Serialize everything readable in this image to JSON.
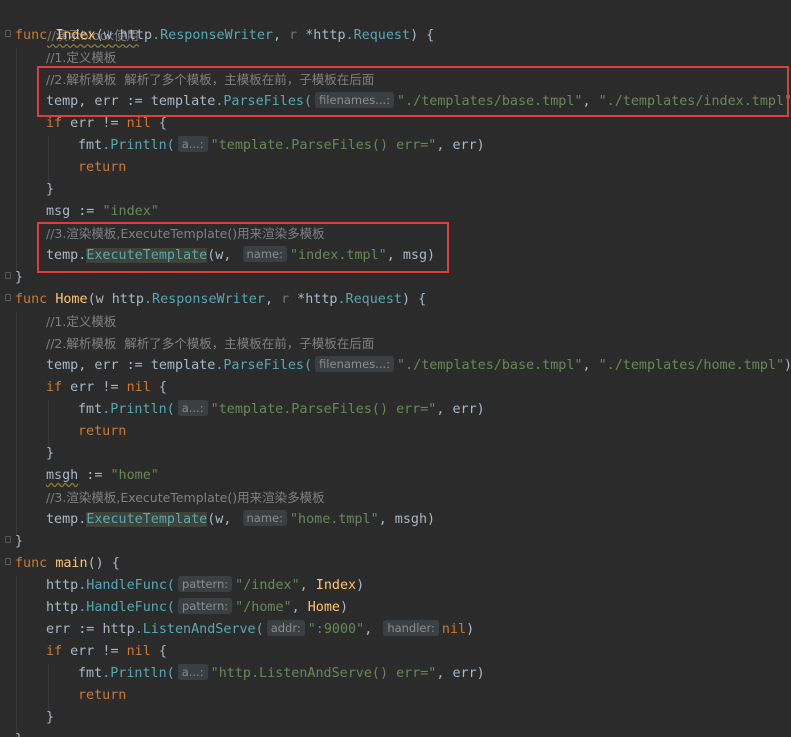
{
  "editor": {
    "title_comment": "//演示block使用",
    "index_func": {
      "kw_func": "func",
      "name": "Index",
      "sig_open": "(w ",
      "writer_pkg": "http",
      "writer_type": ".ResponseWriter",
      "sep": ", ",
      "r_param": "r",
      "req_pkg": " *http",
      "req_type": ".Request",
      "sig_close": ") {",
      "c1": "//1.定义模板",
      "c2": "//2.解析模板  解析了多个模板，主模板在前，子模板在后面",
      "parse_lhs": "temp, err := ",
      "parse_pkg": "template",
      "parse_fn": ".ParseFiles(",
      "parse_hint": "filenames...:",
      "parse_arg1": "\"./templates/base.tmpl\"",
      "parse_comma": ", ",
      "parse_arg2": "\"./templates/index.tmpl\"",
      "parse_close": ")",
      "if_kw": "if",
      "if_cond": " err != ",
      "nil": "nil",
      "if_open": " {",
      "println_pkg": "fmt",
      "println_fn": ".Println(",
      "println_hint": "a...:",
      "println_str": "\"template.ParseFiles() err=\"",
      "println_rest": ", err)",
      "return_kw": "return",
      "close_brace": "}",
      "msg_lhs": "msg := ",
      "msg_str": "\"index\"",
      "c3": "//3.渲染模板,ExecuteTemplate()用来渲染多模板",
      "exec_recv": "temp.",
      "exec_fn": "ExecuteTemplate",
      "exec_open": "(w, ",
      "exec_hint": "name:",
      "exec_str": "\"index.tmpl\"",
      "exec_rest": ", msg)",
      "func_close": "}"
    },
    "home_func": {
      "kw_func": "func",
      "name": "Home",
      "sig_open": "(w ",
      "writer_pkg": "http",
      "writer_type": ".ResponseWriter",
      "sep": ", ",
      "r_param": "r",
      "req_pkg": " *http",
      "req_type": ".Request",
      "sig_close": ") {",
      "c1": "//1.定义模板",
      "c2": "//2.解析模板  解析了多个模板，主模板在前，子模板在后面",
      "parse_lhs": "temp, err := ",
      "parse_pkg": "template",
      "parse_fn": ".ParseFiles(",
      "parse_hint": "filenames...:",
      "parse_arg1": "\"./templates/base.tmpl\"",
      "parse_comma": ", ",
      "parse_arg2": "\"./templates/home.tmpl\"",
      "parse_close": ")",
      "if_kw": "if",
      "if_cond": " err != ",
      "nil": "nil",
      "if_open": " {",
      "println_pkg": "fmt",
      "println_fn": ".Println(",
      "println_hint": "a...:",
      "println_str": "\"template.ParseFiles() err=\"",
      "println_rest": ", err)",
      "return_kw": "return",
      "close_brace": "}",
      "msgh_var": "msgh",
      "msgh_op": " := ",
      "msgh_str": "\"home\"",
      "c3": "//3.渲染模板,ExecuteTemplate()用来渲染多模板",
      "exec_recv": "temp.",
      "exec_fn": "ExecuteTemplate",
      "exec_open": "(w, ",
      "exec_hint": "name:",
      "exec_str": "\"home.tmpl\"",
      "exec_rest": ", msgh)",
      "func_close": "}"
    },
    "main_func": {
      "kw_func": "func",
      "name": "main",
      "sig": "() {",
      "h1_pkg": "http",
      "h1_fn": ".HandleFunc(",
      "h1_hint": "pattern:",
      "h1_str": "\"/index\"",
      "h1_comma": ", ",
      "h1_handler": "Index",
      "h1_close": ")",
      "h2_pkg": "http",
      "h2_fn": ".HandleFunc(",
      "h2_hint": "pattern:",
      "h2_str": "\"/home\"",
      "h2_comma": ", ",
      "h2_handler": "Home",
      "h2_close": ")",
      "ls_lhs": "err := ",
      "ls_pkg": "http",
      "ls_fn": ".ListenAndServe(",
      "ls_hint1": "addr:",
      "ls_str": "\":9000\"",
      "ls_comma": ", ",
      "ls_hint2": "handler:",
      "ls_nil": "nil",
      "ls_close": ")",
      "if_kw": "if",
      "if_cond": " err != ",
      "nil": "nil",
      "if_open": " {",
      "println_pkg": "fmt",
      "println_fn": ".Println(",
      "println_hint": "a...:",
      "println_str": "\"http.ListenAndServe() err=\"",
      "println_rest": ", err)",
      "return_kw": "return",
      "close_brace": "}",
      "func_close": "}"
    }
  }
}
